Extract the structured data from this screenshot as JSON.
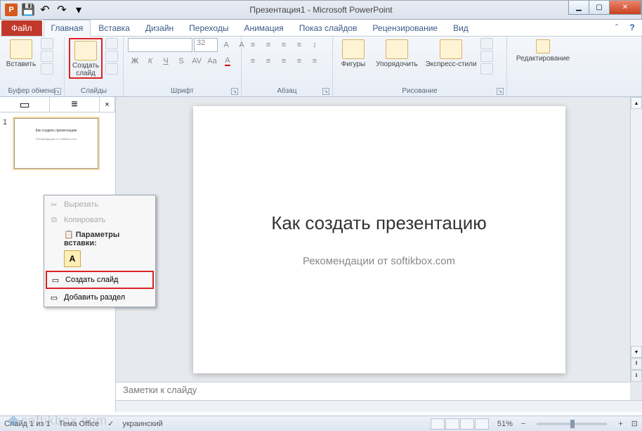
{
  "window": {
    "title": "Презентация1 - Microsoft PowerPoint"
  },
  "qat": {
    "save": "💾",
    "undo": "↶",
    "redo": "↷"
  },
  "tabs": {
    "file": "Файл",
    "items": [
      "Главная",
      "Вставка",
      "Дизайн",
      "Переходы",
      "Анимация",
      "Показ слайдов",
      "Рецензирование",
      "Вид"
    ],
    "active": 0
  },
  "ribbon": {
    "clipboard": {
      "label": "Буфер обмена",
      "paste": "Вставить"
    },
    "slides": {
      "label": "Слайды",
      "new_slide": "Создать\nслайд"
    },
    "font": {
      "label": "Шрифт",
      "size": "32"
    },
    "para": {
      "label": "Абзац"
    },
    "draw": {
      "label": "Рисование",
      "shapes": "Фигуры",
      "arrange": "Упорядочить",
      "styles": "Экспресс-стили"
    },
    "edit": {
      "label": "Редактирование"
    }
  },
  "thumbs": {
    "n1": "1"
  },
  "slide": {
    "title": "Как создать презентацию",
    "subtitle": "Рекомендации от softikbox.com"
  },
  "notes": {
    "placeholder": "Заметки к слайду"
  },
  "context": {
    "cut": "Вырезать",
    "copy": "Копировать",
    "paste_label": "Параметры вставки:",
    "paste_opt": "A",
    "new_slide": "Создать слайд",
    "add_section": "Добавить раздел"
  },
  "status": {
    "slide_info": "Слайд 1 из 1",
    "theme": "Тема Office",
    "lang": "украинский",
    "zoom": "51%"
  },
  "watermark": "softikbox.com"
}
